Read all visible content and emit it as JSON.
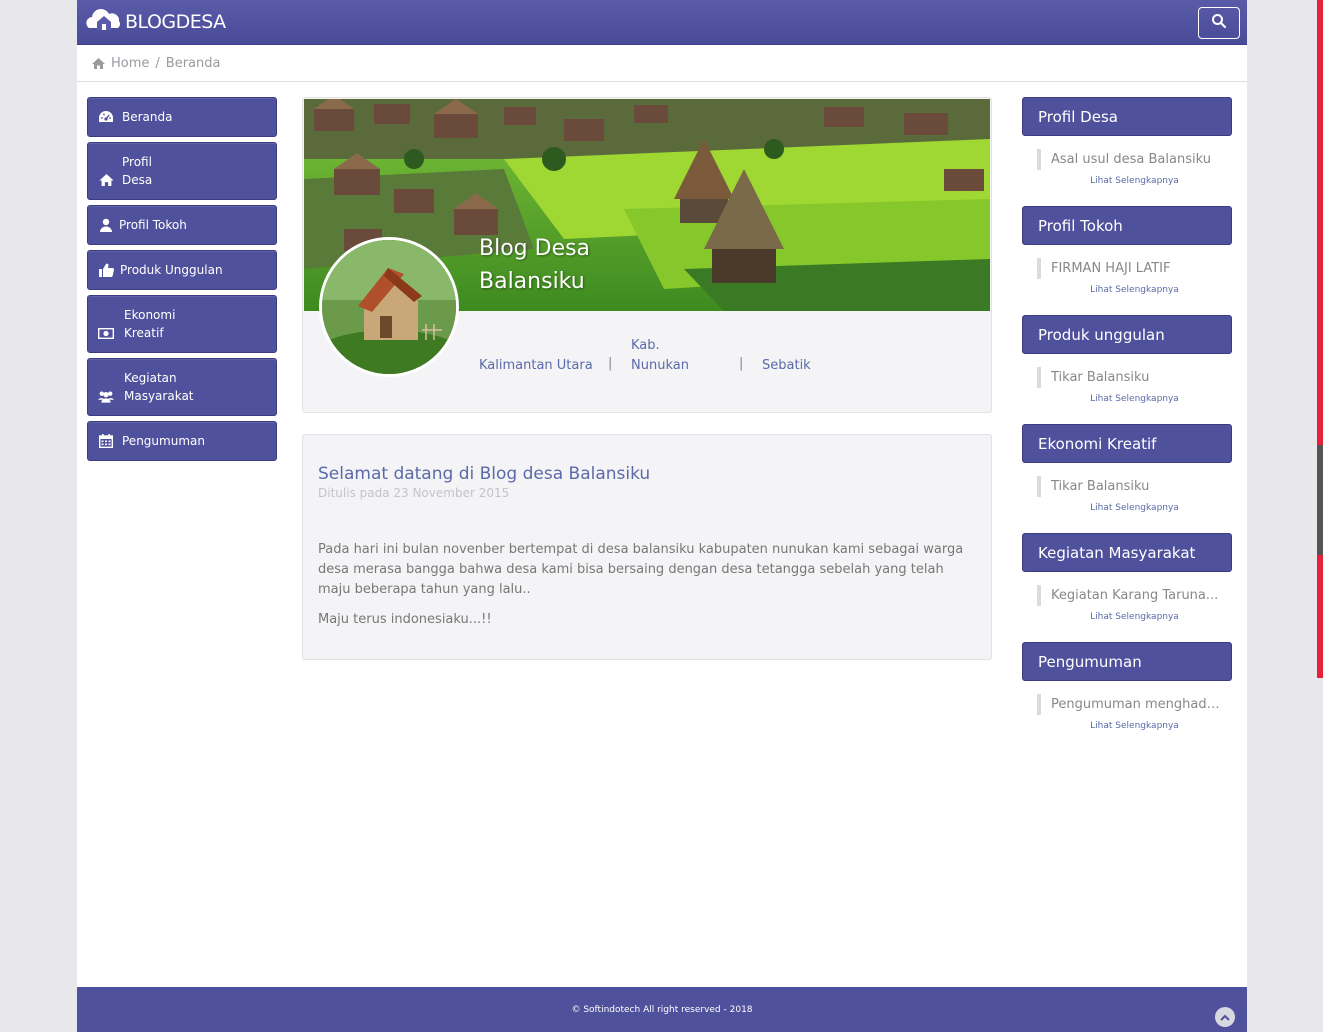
{
  "header": {
    "brand": "BLOGDESA",
    "logo_icon": "house-cloud-icon",
    "search_icon": "search-icon"
  },
  "breadcrumb": {
    "home": "Home",
    "separator": "/",
    "current": "Beranda"
  },
  "sidebar": {
    "items": [
      {
        "label": "Beranda",
        "icon": "dashboard-icon"
      },
      {
        "label": "Profil",
        "label2": "Desa",
        "icon": "home-icon"
      },
      {
        "label": "Profil Tokoh",
        "icon": "user-icon"
      },
      {
        "label": "Produk Unggulan",
        "icon": "thumbs-up-icon"
      },
      {
        "label": "Ekonomi",
        "label2": "Kreatif",
        "icon": "money-icon"
      },
      {
        "label": "Kegiatan",
        "label2": "Masyarakat",
        "icon": "users-icon"
      },
      {
        "label": "Pengumuman",
        "icon": "calendar-icon"
      }
    ]
  },
  "profile": {
    "title_line1": "Blog Desa",
    "title_line2": "Balansiku",
    "province": "Kalimantan Utara",
    "sep1": "|",
    "kab_line1": "Kab.",
    "kab_line2": "Nunukan",
    "sep2": "|",
    "kecamatan": "Sebatik"
  },
  "post": {
    "title": "Selamat datang di  Blog desa  Balansiku",
    "date": "Ditulis pada 23  November 2015",
    "paragraph1": "Pada hari ini bulan novenber bertempat di desa balansiku kabupaten nunukan kami sebagai warga desa merasa bangga bahwa desa kami bisa bersaing dengan desa tetangga sebelah yang telah maju beberapa tahun yang lalu..",
    "paragraph2": "Maju terus indonesiaku...!!"
  },
  "widgets": [
    {
      "title": "Profil Desa",
      "item": "Asal usul desa  Balansiku",
      "more": "Lihat Selengkapnya"
    },
    {
      "title": "Profil Tokoh",
      "item": "FIRMAN HAJI LATIF",
      "more": "Lihat Selengkapnya"
    },
    {
      "title": "Produk unggulan",
      "item": "Tikar Balansiku",
      "more": "Lihat Selengkapnya"
    },
    {
      "title": "Ekonomi  Kreatif",
      "item": "Tikar Balansiku",
      "more": "Lihat Selengkapnya"
    },
    {
      "title": "Kegiatan  Masyarakat",
      "item": "Kegiatan  Karang Taruna...",
      "more": "Lihat Selengkapnya"
    },
    {
      "title": "Pengumuman",
      "item": "Pengumuman  menghadapi...",
      "more": "Lihat Selengkapnya"
    }
  ],
  "footer": {
    "copyright": "© Softindotech All right reserved - 2018",
    "to_top_icon": "chevron-up-icon"
  },
  "colors": {
    "primary": "#50519d",
    "link": "#5a6aa8",
    "accent": "#e8213a"
  }
}
